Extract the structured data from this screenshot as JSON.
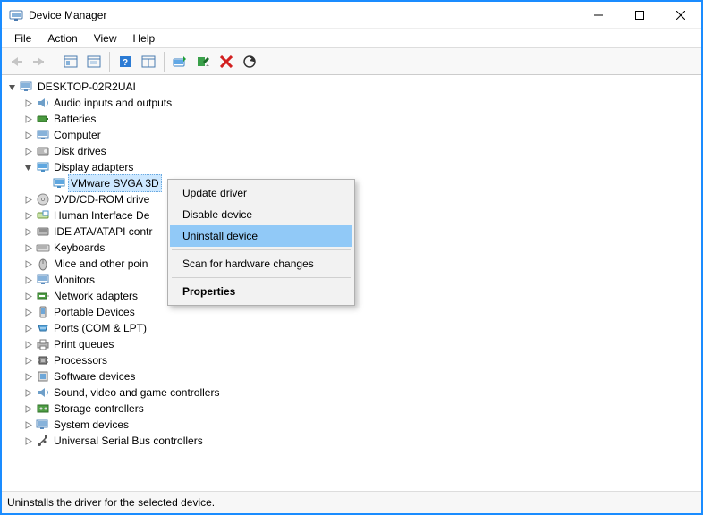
{
  "window": {
    "title": "Device Manager"
  },
  "menu": {
    "file": "File",
    "action": "Action",
    "view": "View",
    "help": "Help"
  },
  "tree": {
    "root": "DESKTOP-02R2UAI",
    "items": {
      "audio": "Audio inputs and outputs",
      "batteries": "Batteries",
      "computer": "Computer",
      "disk": "Disk drives",
      "display": "Display adapters",
      "display_child": "VMware SVGA 3D",
      "dvd": "DVD/CD-ROM drive",
      "hid": "Human Interface De",
      "ide": "IDE ATA/ATAPI contr",
      "keyboards": "Keyboards",
      "mice": "Mice and other poin",
      "monitors": "Monitors",
      "network": "Network adapters",
      "portable": "Portable Devices",
      "ports": "Ports (COM & LPT)",
      "printq": "Print queues",
      "processors": "Processors",
      "software": "Software devices",
      "sound": "Sound, video and game controllers",
      "storage": "Storage controllers",
      "system": "System devices",
      "usb": "Universal Serial Bus controllers"
    }
  },
  "context_menu": {
    "update": "Update driver",
    "disable": "Disable device",
    "uninstall": "Uninstall device",
    "scan": "Scan for hardware changes",
    "properties": "Properties"
  },
  "statusbar": {
    "text": "Uninstalls the driver for the selected device."
  }
}
